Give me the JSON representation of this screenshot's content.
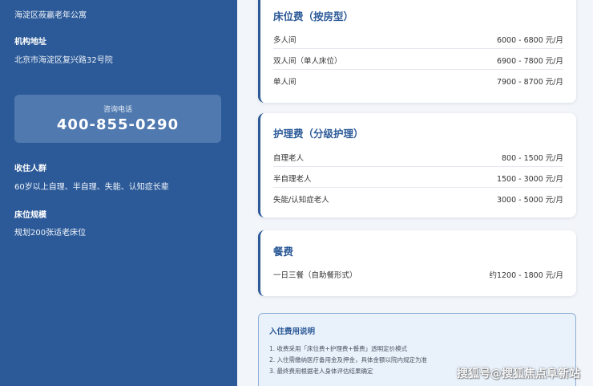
{
  "sidebar": {
    "name_value": "海淀区莜赢老年公寓",
    "address_label": "机构地址",
    "address_value": "北京市海淀区复兴路32号院",
    "phone_label": "咨询电话",
    "phone_number": "400-855-0290",
    "audience_label": "收住人群",
    "audience_value": "60岁以上自理、半自理、失能、认知症长辈",
    "beds_label": "床位规模",
    "beds_value": "规划200张适老床位"
  },
  "bed_fee": {
    "title": "床位费（按房型）",
    "rows": [
      {
        "name": "多人间",
        "price": "6000 - 6800 元/月"
      },
      {
        "name": "双人间（单人床位）",
        "price": "6900 - 7800 元/月"
      },
      {
        "name": "单人间",
        "price": "7900 - 8700 元/月"
      }
    ]
  },
  "care_fee": {
    "title": "护理费（分级护理）",
    "rows": [
      {
        "name": "自理老人",
        "price": "800 - 1500 元/月"
      },
      {
        "name": "半自理老人",
        "price": "1500 - 3000 元/月"
      },
      {
        "name": "失能/认知症老人",
        "price": "3000 - 5000 元/月"
      }
    ]
  },
  "meal_fee": {
    "title": "餐费",
    "rows": [
      {
        "name": "一日三餐（自助餐形式）",
        "price": "约1200 - 1800 元/月"
      }
    ]
  },
  "notes": {
    "title": "入住费用说明",
    "items": [
      "1. 收费采用「床位费+护理费+餐费」透明定价模式",
      "2. 入住需缴纳医疗备用金及押金，具体金额以院内规定为准",
      "3. 最终费用根据老人身体评估结果确定"
    ]
  },
  "watermark": "搜狐号@搜狐焦点阜新站",
  "colors": {
    "accent": "#2c5a98",
    "sidebar_bg": "#2c5a98",
    "note_bg": "#e9f1fa"
  }
}
